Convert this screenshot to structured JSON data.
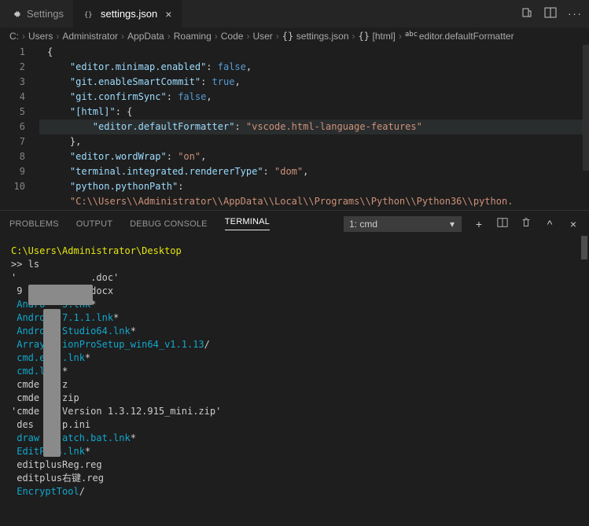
{
  "tabs": [
    {
      "label": "Settings",
      "icon": "settings"
    },
    {
      "label": "settings.json",
      "icon": "json",
      "active": true,
      "closable": true
    }
  ],
  "breadcrumbs": {
    "parts": [
      "C:",
      "Users",
      "Administrator",
      "AppData",
      "Roaming",
      "Code",
      "User",
      "settings.json",
      "[html]",
      "editor.defaultFormatter"
    ]
  },
  "editor": {
    "lines": [
      {
        "n": 1,
        "tokens": [
          [
            "p",
            "{"
          ]
        ]
      },
      {
        "n": 2,
        "tokens": [
          [
            "p",
            "    "
          ],
          [
            "k",
            "\"editor.minimap.enabled\""
          ],
          [
            "p",
            ": "
          ],
          [
            "b",
            "false"
          ],
          [
            "p",
            ","
          ]
        ]
      },
      {
        "n": 3,
        "tokens": [
          [
            "p",
            "    "
          ],
          [
            "k",
            "\"git.enableSmartCommit\""
          ],
          [
            "p",
            ": "
          ],
          [
            "b",
            "true"
          ],
          [
            "p",
            ","
          ]
        ]
      },
      {
        "n": 4,
        "tokens": [
          [
            "p",
            "    "
          ],
          [
            "k",
            "\"git.confirmSync\""
          ],
          [
            "p",
            ": "
          ],
          [
            "b",
            "false"
          ],
          [
            "p",
            ","
          ]
        ]
      },
      {
        "n": 5,
        "tokens": [
          [
            "p",
            "    "
          ],
          [
            "k",
            "\"[html]\""
          ],
          [
            "p",
            ": {"
          ]
        ]
      },
      {
        "n": 6,
        "hl": true,
        "tokens": [
          [
            "p",
            "        "
          ],
          [
            "k",
            "\"editor.defaultFormatter\""
          ],
          [
            "p",
            ": "
          ],
          [
            "s",
            "\"vscode.html-language-features\""
          ]
        ]
      },
      {
        "n": 7,
        "tokens": [
          [
            "p",
            "    },"
          ]
        ]
      },
      {
        "n": 8,
        "tokens": [
          [
            "p",
            "    "
          ],
          [
            "k",
            "\"editor.wordWrap\""
          ],
          [
            "p",
            ": "
          ],
          [
            "s",
            "\"on\""
          ],
          [
            "p",
            ","
          ]
        ]
      },
      {
        "n": 9,
        "tokens": [
          [
            "p",
            "    "
          ],
          [
            "k",
            "\"terminal.integrated.rendererType\""
          ],
          [
            "p",
            ": "
          ],
          [
            "s",
            "\"dom\""
          ],
          [
            "p",
            ","
          ]
        ]
      },
      {
        "n": 10,
        "tokens": [
          [
            "p",
            "    "
          ],
          [
            "k",
            "\"python.pythonPath\""
          ],
          [
            "p",
            ":"
          ]
        ]
      },
      {
        "n": "",
        "tokens": [
          [
            "p",
            "    "
          ],
          [
            "s",
            "\"C:\\\\Users\\\\Administrator\\\\AppData\\\\Local\\\\Programs\\\\Python\\\\Python36\\\\python."
          ]
        ]
      }
    ]
  },
  "panel": {
    "tabs": {
      "problems": "PROBLEMS",
      "output": "OUTPUT",
      "debug": "DEBUG CONSOLE",
      "terminal": "TERMINAL"
    },
    "select": "1: cmd",
    "terminal_lines": [
      {
        "segs": [
          [
            "ty",
            "C:\\Users\\Administrator\\Desktop"
          ]
        ]
      },
      {
        "segs": [
          [
            "tw",
            ">> ls"
          ]
        ]
      },
      {
        "segs": [
          [
            "tw",
            "'"
          ],
          [
            "tw",
            "             .doc'"
          ]
        ]
      },
      {
        "segs": [
          [
            "tw",
            " 9           .docx"
          ]
        ]
      },
      {
        "segs": [
          [
            "tc",
            " Andro   5.lnk"
          ],
          [
            "tw",
            "*"
          ]
        ]
      },
      {
        "segs": [
          [
            "tc",
            " Andro   7.1.1.lnk"
          ],
          [
            "tw",
            "*"
          ]
        ]
      },
      {
        "segs": [
          [
            "tc",
            " Andro   Studio64.lnk"
          ],
          [
            "tw",
            "*"
          ]
        ]
      },
      {
        "segs": [
          [
            "tc",
            " Array   ionProSetup_win64_v1.1.13"
          ],
          [
            "tw",
            "/"
          ]
        ]
      },
      {
        "segs": [
          [
            "tc",
            " cmd.e   .lnk"
          ],
          [
            "tw",
            "*"
          ]
        ]
      },
      {
        "segs": [
          [
            "tc",
            " cmd.l   "
          ],
          [
            "tw",
            "*"
          ]
        ]
      },
      {
        "segs": [
          [
            "tw",
            " cmde    z"
          ]
        ]
      },
      {
        "segs": [
          [
            "tw",
            " cmde    zip"
          ]
        ]
      },
      {
        "segs": [
          [
            "tw",
            "'cmde    Version 1.3.12.915_mini.zip'"
          ]
        ]
      },
      {
        "segs": [
          [
            "tw",
            " des     p.ini"
          ]
        ]
      },
      {
        "segs": [
          [
            "tc",
            " draw    atch.bat.lnk"
          ],
          [
            "tw",
            "*"
          ]
        ]
      },
      {
        "segs": [
          [
            "tc",
            " EditPlus.lnk"
          ],
          [
            "tw",
            "*"
          ]
        ]
      },
      {
        "segs": [
          [
            "tw",
            " editplusReg.reg"
          ]
        ]
      },
      {
        "segs": [
          [
            "tw",
            " editplus右键.reg"
          ]
        ]
      },
      {
        "segs": [
          [
            "tc",
            " EncryptTool"
          ],
          [
            "tw",
            "/"
          ]
        ]
      }
    ]
  }
}
